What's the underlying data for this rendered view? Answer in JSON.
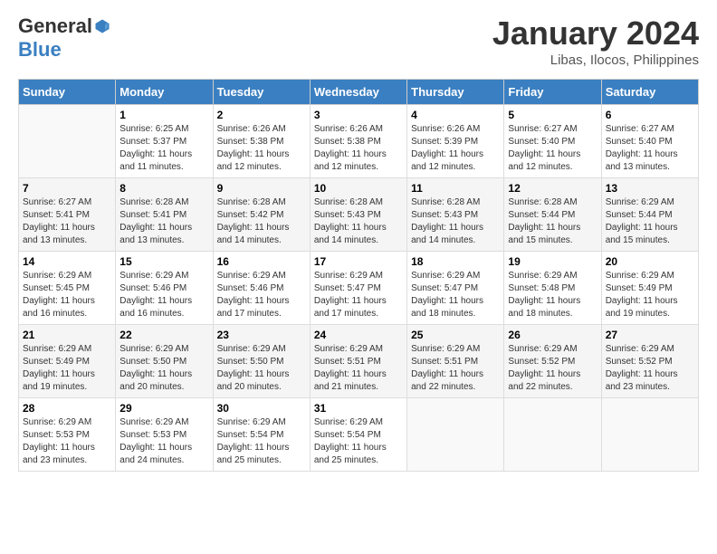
{
  "logo": {
    "general": "General",
    "blue": "Blue"
  },
  "title": "January 2024",
  "subtitle": "Libas, Ilocos, Philippines",
  "headers": [
    "Sunday",
    "Monday",
    "Tuesday",
    "Wednesday",
    "Thursday",
    "Friday",
    "Saturday"
  ],
  "weeks": [
    [
      {
        "day": "",
        "info": ""
      },
      {
        "day": "1",
        "info": "Sunrise: 6:25 AM\nSunset: 5:37 PM\nDaylight: 11 hours\nand 11 minutes."
      },
      {
        "day": "2",
        "info": "Sunrise: 6:26 AM\nSunset: 5:38 PM\nDaylight: 11 hours\nand 12 minutes."
      },
      {
        "day": "3",
        "info": "Sunrise: 6:26 AM\nSunset: 5:38 PM\nDaylight: 11 hours\nand 12 minutes."
      },
      {
        "day": "4",
        "info": "Sunrise: 6:26 AM\nSunset: 5:39 PM\nDaylight: 11 hours\nand 12 minutes."
      },
      {
        "day": "5",
        "info": "Sunrise: 6:27 AM\nSunset: 5:40 PM\nDaylight: 11 hours\nand 12 minutes."
      },
      {
        "day": "6",
        "info": "Sunrise: 6:27 AM\nSunset: 5:40 PM\nDaylight: 11 hours\nand 13 minutes."
      }
    ],
    [
      {
        "day": "7",
        "info": "Sunrise: 6:27 AM\nSunset: 5:41 PM\nDaylight: 11 hours\nand 13 minutes."
      },
      {
        "day": "8",
        "info": "Sunrise: 6:28 AM\nSunset: 5:41 PM\nDaylight: 11 hours\nand 13 minutes."
      },
      {
        "day": "9",
        "info": "Sunrise: 6:28 AM\nSunset: 5:42 PM\nDaylight: 11 hours\nand 14 minutes."
      },
      {
        "day": "10",
        "info": "Sunrise: 6:28 AM\nSunset: 5:43 PM\nDaylight: 11 hours\nand 14 minutes."
      },
      {
        "day": "11",
        "info": "Sunrise: 6:28 AM\nSunset: 5:43 PM\nDaylight: 11 hours\nand 14 minutes."
      },
      {
        "day": "12",
        "info": "Sunrise: 6:28 AM\nSunset: 5:44 PM\nDaylight: 11 hours\nand 15 minutes."
      },
      {
        "day": "13",
        "info": "Sunrise: 6:29 AM\nSunset: 5:44 PM\nDaylight: 11 hours\nand 15 minutes."
      }
    ],
    [
      {
        "day": "14",
        "info": "Sunrise: 6:29 AM\nSunset: 5:45 PM\nDaylight: 11 hours\nand 16 minutes."
      },
      {
        "day": "15",
        "info": "Sunrise: 6:29 AM\nSunset: 5:46 PM\nDaylight: 11 hours\nand 16 minutes."
      },
      {
        "day": "16",
        "info": "Sunrise: 6:29 AM\nSunset: 5:46 PM\nDaylight: 11 hours\nand 17 minutes."
      },
      {
        "day": "17",
        "info": "Sunrise: 6:29 AM\nSunset: 5:47 PM\nDaylight: 11 hours\nand 17 minutes."
      },
      {
        "day": "18",
        "info": "Sunrise: 6:29 AM\nSunset: 5:47 PM\nDaylight: 11 hours\nand 18 minutes."
      },
      {
        "day": "19",
        "info": "Sunrise: 6:29 AM\nSunset: 5:48 PM\nDaylight: 11 hours\nand 18 minutes."
      },
      {
        "day": "20",
        "info": "Sunrise: 6:29 AM\nSunset: 5:49 PM\nDaylight: 11 hours\nand 19 minutes."
      }
    ],
    [
      {
        "day": "21",
        "info": "Sunrise: 6:29 AM\nSunset: 5:49 PM\nDaylight: 11 hours\nand 19 minutes."
      },
      {
        "day": "22",
        "info": "Sunrise: 6:29 AM\nSunset: 5:50 PM\nDaylight: 11 hours\nand 20 minutes."
      },
      {
        "day": "23",
        "info": "Sunrise: 6:29 AM\nSunset: 5:50 PM\nDaylight: 11 hours\nand 20 minutes."
      },
      {
        "day": "24",
        "info": "Sunrise: 6:29 AM\nSunset: 5:51 PM\nDaylight: 11 hours\nand 21 minutes."
      },
      {
        "day": "25",
        "info": "Sunrise: 6:29 AM\nSunset: 5:51 PM\nDaylight: 11 hours\nand 22 minutes."
      },
      {
        "day": "26",
        "info": "Sunrise: 6:29 AM\nSunset: 5:52 PM\nDaylight: 11 hours\nand 22 minutes."
      },
      {
        "day": "27",
        "info": "Sunrise: 6:29 AM\nSunset: 5:52 PM\nDaylight: 11 hours\nand 23 minutes."
      }
    ],
    [
      {
        "day": "28",
        "info": "Sunrise: 6:29 AM\nSunset: 5:53 PM\nDaylight: 11 hours\nand 23 minutes."
      },
      {
        "day": "29",
        "info": "Sunrise: 6:29 AM\nSunset: 5:53 PM\nDaylight: 11 hours\nand 24 minutes."
      },
      {
        "day": "30",
        "info": "Sunrise: 6:29 AM\nSunset: 5:54 PM\nDaylight: 11 hours\nand 25 minutes."
      },
      {
        "day": "31",
        "info": "Sunrise: 6:29 AM\nSunset: 5:54 PM\nDaylight: 11 hours\nand 25 minutes."
      },
      {
        "day": "",
        "info": ""
      },
      {
        "day": "",
        "info": ""
      },
      {
        "day": "",
        "info": ""
      }
    ]
  ]
}
